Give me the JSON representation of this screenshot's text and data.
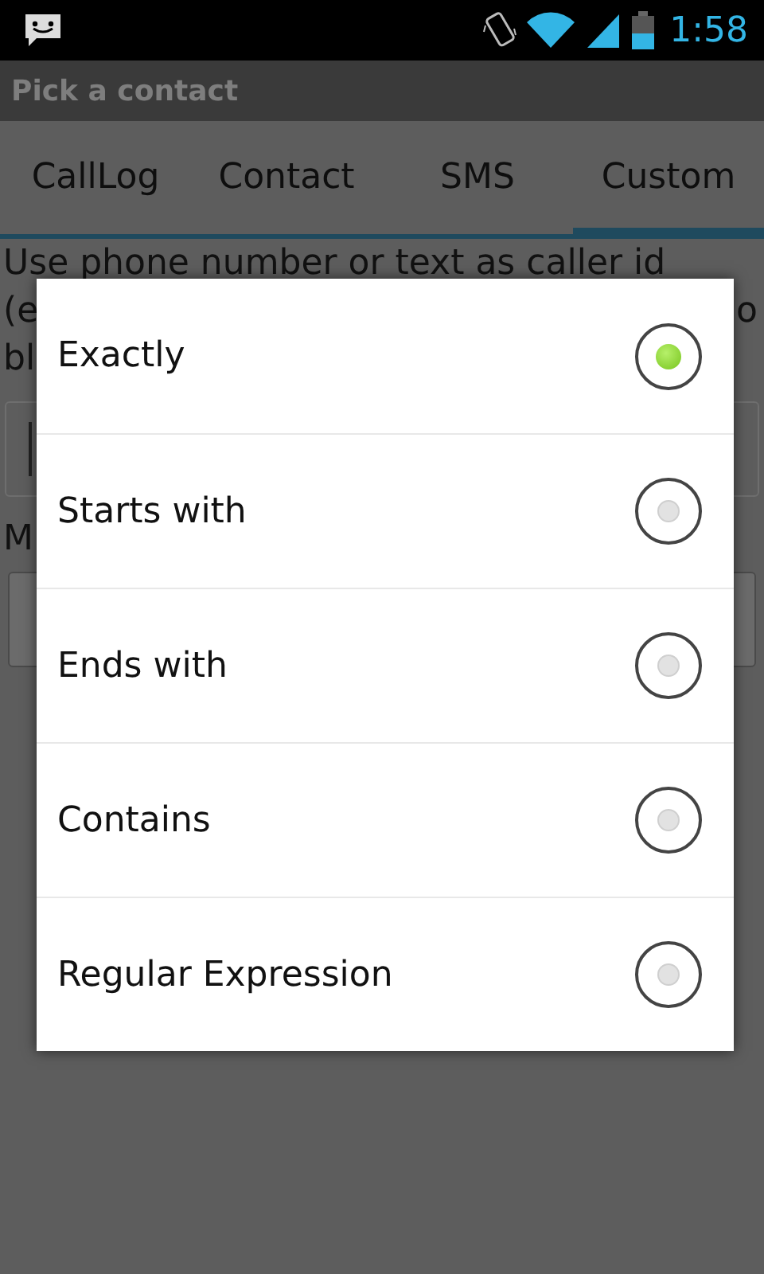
{
  "status_bar": {
    "time": "1:58"
  },
  "title_bar": {
    "title": "Pick a contact"
  },
  "tabs": [
    {
      "label": "CallLog",
      "selected": false
    },
    {
      "label": "Contact",
      "selected": false
    },
    {
      "label": "SMS",
      "selected": false
    },
    {
      "label": "Custom",
      "selected": true
    }
  ],
  "background": {
    "description_line": "Use phone number or text as caller id",
    "fragments": [
      {
        "left": "(e",
        "right": "o"
      },
      {
        "left": "bl"
      }
    ],
    "match_label": "M"
  },
  "dialog": {
    "options": [
      {
        "label": "Exactly",
        "selected": true
      },
      {
        "label": "Starts with",
        "selected": false
      },
      {
        "label": "Ends with",
        "selected": false
      },
      {
        "label": "Contains",
        "selected": false
      },
      {
        "label": "Regular Expression",
        "selected": false
      }
    ]
  }
}
